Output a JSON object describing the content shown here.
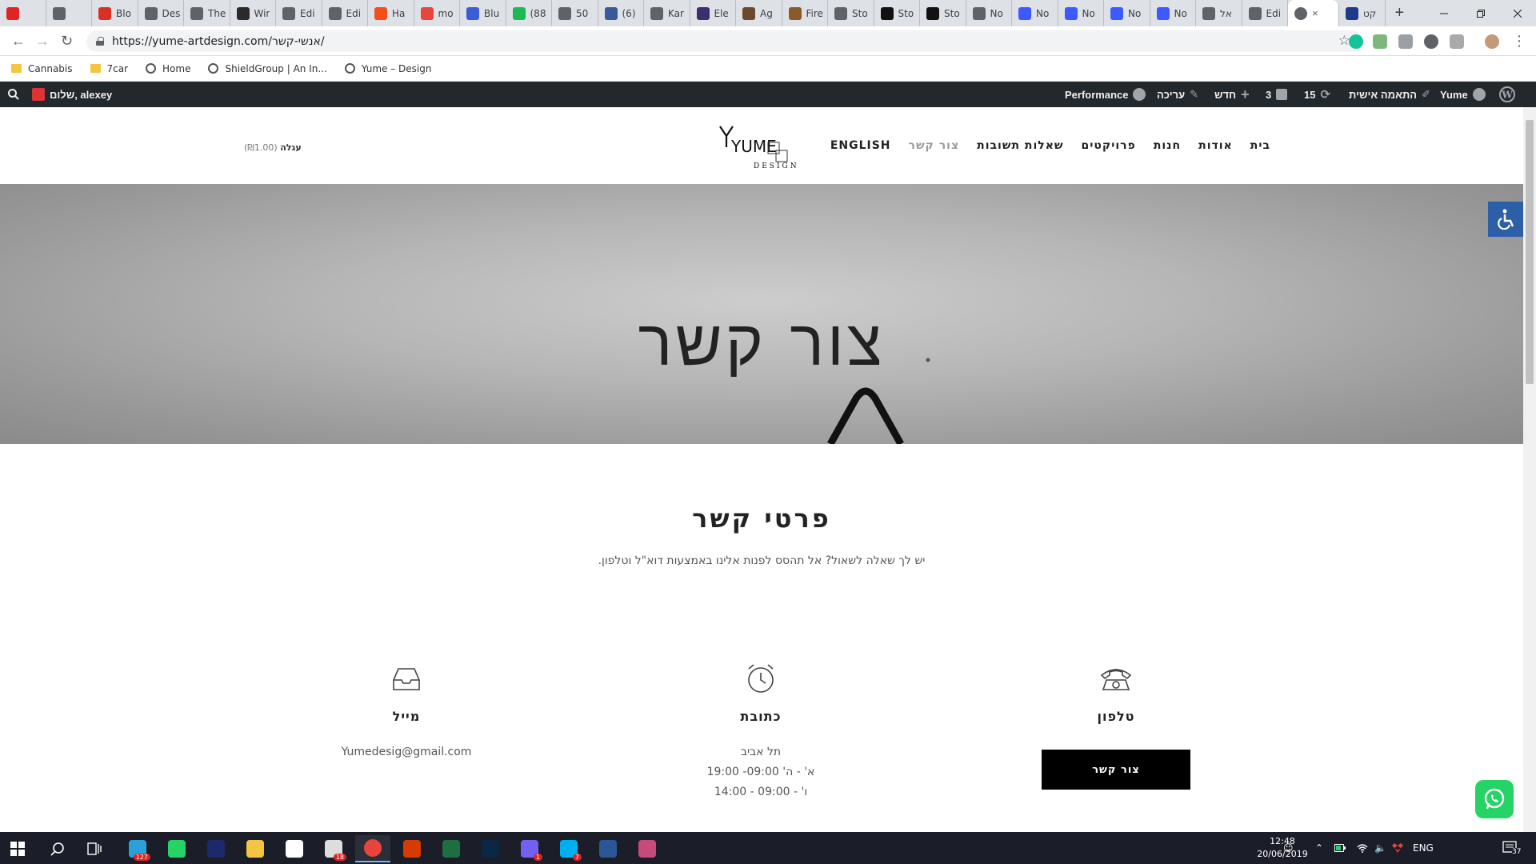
{
  "browser": {
    "tabs": [
      {
        "label": "",
        "color": "#e02424",
        "icon": "youtube-icon"
      },
      {
        "label": "",
        "color": "#5f6368",
        "icon": "speaker-icon"
      },
      {
        "label": "Blo",
        "color": "#d93025",
        "icon": "gmail-icon"
      },
      {
        "label": "Des",
        "color": "#5f6368",
        "icon": "globe-icon"
      },
      {
        "label": "The",
        "color": "#5f6368",
        "icon": "globe-icon"
      },
      {
        "label": "Wir",
        "color": "#2a2a2a",
        "icon": "app-icon"
      },
      {
        "label": "Edi",
        "color": "#5f6368",
        "icon": "globe-icon"
      },
      {
        "label": "Edi",
        "color": "#5f6368",
        "icon": "globe-icon"
      },
      {
        "label": "Ha",
        "color": "#f24e1e",
        "icon": "figma-icon"
      },
      {
        "label": "mo",
        "color": "#e8453c",
        "icon": "monday-icon"
      },
      {
        "label": "Blu",
        "color": "#3b5cd6",
        "icon": "grid-icon"
      },
      {
        "label": "(88",
        "color": "#1db954",
        "icon": "app-icon"
      },
      {
        "label": "50",
        "color": "#5f6368",
        "icon": "globe-icon"
      },
      {
        "label": "(6)",
        "color": "#3b5998",
        "icon": "facebook-icon"
      },
      {
        "label": "Kar",
        "color": "#5f6368",
        "icon": "globe-icon"
      },
      {
        "label": "Ele",
        "color": "#3b2f6e",
        "icon": "app-icon"
      },
      {
        "label": "Ag",
        "color": "#6b4a2b",
        "icon": "app-icon"
      },
      {
        "label": "Fire",
        "color": "#8a5a2b",
        "icon": "app-icon"
      },
      {
        "label": "Sto",
        "color": "#5f6368",
        "icon": "globe-icon"
      },
      {
        "label": "Sto",
        "color": "#111111",
        "icon": "st-icon"
      },
      {
        "label": "Sto",
        "color": "#111111",
        "icon": "st-icon"
      },
      {
        "label": "No",
        "color": "#5f6368",
        "icon": "globe-icon"
      },
      {
        "label": "No",
        "color": "#3d5afe",
        "icon": "n-icon"
      },
      {
        "label": "No",
        "color": "#3d5afe",
        "icon": "n-icon"
      },
      {
        "label": "No",
        "color": "#3d5afe",
        "icon": "n-icon"
      },
      {
        "label": "No",
        "color": "#3d5afe",
        "icon": "n-icon"
      },
      {
        "label": "אל",
        "color": "#5f6368",
        "icon": "globe-icon"
      },
      {
        "label": "Edi",
        "color": "#5f6368",
        "icon": "globe-icon"
      }
    ],
    "active_tab_close": "×",
    "last_tab_label": "קט",
    "new_tab": "+",
    "url": "https://yume-artdesign.com/אנשי-קשר/",
    "bookmarks": [
      {
        "label": "Cannabis",
        "type": "folder"
      },
      {
        "label": "7car",
        "type": "folder"
      },
      {
        "label": "Home",
        "type": "page"
      },
      {
        "label": "ShieldGroup | An In...",
        "type": "page"
      },
      {
        "label": "Yume – Design",
        "type": "page"
      }
    ]
  },
  "wpbar": {
    "greeting": "שלום, alexey",
    "performance": "Performance",
    "edit": "עריכה",
    "new": "חדש",
    "comments": "3",
    "updates": "15",
    "customize": "התאמה אישית",
    "site": "Yume"
  },
  "site": {
    "nav": [
      "בית",
      "אודות",
      "חנות",
      "פרויקטים",
      "שאלות תשובות",
      "צור קשר",
      "ENGLISH"
    ],
    "current_nav": "צור קשר",
    "logo_top": "YUME",
    "logo_bottom": "DESIGN",
    "cart_label": "עגלה",
    "cart_price": "(₪1.00)"
  },
  "hero": {
    "title": "צור קשר"
  },
  "contact": {
    "heading": "פרטי קשר",
    "subtitle": "יש לך שאלה  לשאול? אל תהסס לפנות אלינו באמצעות דוא\"ל וטלפון.",
    "phone_title": "טלפון",
    "phone_button": "צור קשר",
    "address_title": "כתובת",
    "address_lines": [
      "תל אביב",
      "א' - ה' 09:00- 19:00",
      "ו' - 09:00 - 14:00"
    ],
    "email_title": "מייל",
    "email": "Yumedesig@gmail.com"
  },
  "taskbar": {
    "apps": [
      {
        "name": "telegram",
        "color": "#2aa1da",
        "badge": "127"
      },
      {
        "name": "whatsapp",
        "color": "#25d366",
        "badge": ""
      },
      {
        "name": "xe",
        "color": "#1c2a6b",
        "badge": ""
      },
      {
        "name": "file-explorer",
        "color": "#f5c542",
        "badge": ""
      },
      {
        "name": "store",
        "color": "#ffffff",
        "badge": ""
      },
      {
        "name": "mail",
        "color": "#dddddd",
        "badge": "18"
      },
      {
        "name": "chrome",
        "color": "#e8453c",
        "badge": ""
      },
      {
        "name": "calendar",
        "color": "#d83b01",
        "badge": ""
      },
      {
        "name": "excel",
        "color": "#1d6f42",
        "badge": ""
      },
      {
        "name": "photoshop",
        "color": "#0a2843",
        "badge": ""
      },
      {
        "name": "viber",
        "color": "#7360f2",
        "badge": "1"
      },
      {
        "name": "skype",
        "color": "#00aff0",
        "badge": "7"
      },
      {
        "name": "word",
        "color": "#2b5797",
        "badge": ""
      },
      {
        "name": "paint",
        "color": "#c64b7b",
        "badge": ""
      }
    ],
    "lang": "ENG",
    "time": "12:48",
    "date": "20/06/2019",
    "notifications": "37"
  },
  "colors": {
    "accent": "#2d5fa8",
    "wp_bar": "#23282d",
    "whatsapp": "#25d366"
  }
}
